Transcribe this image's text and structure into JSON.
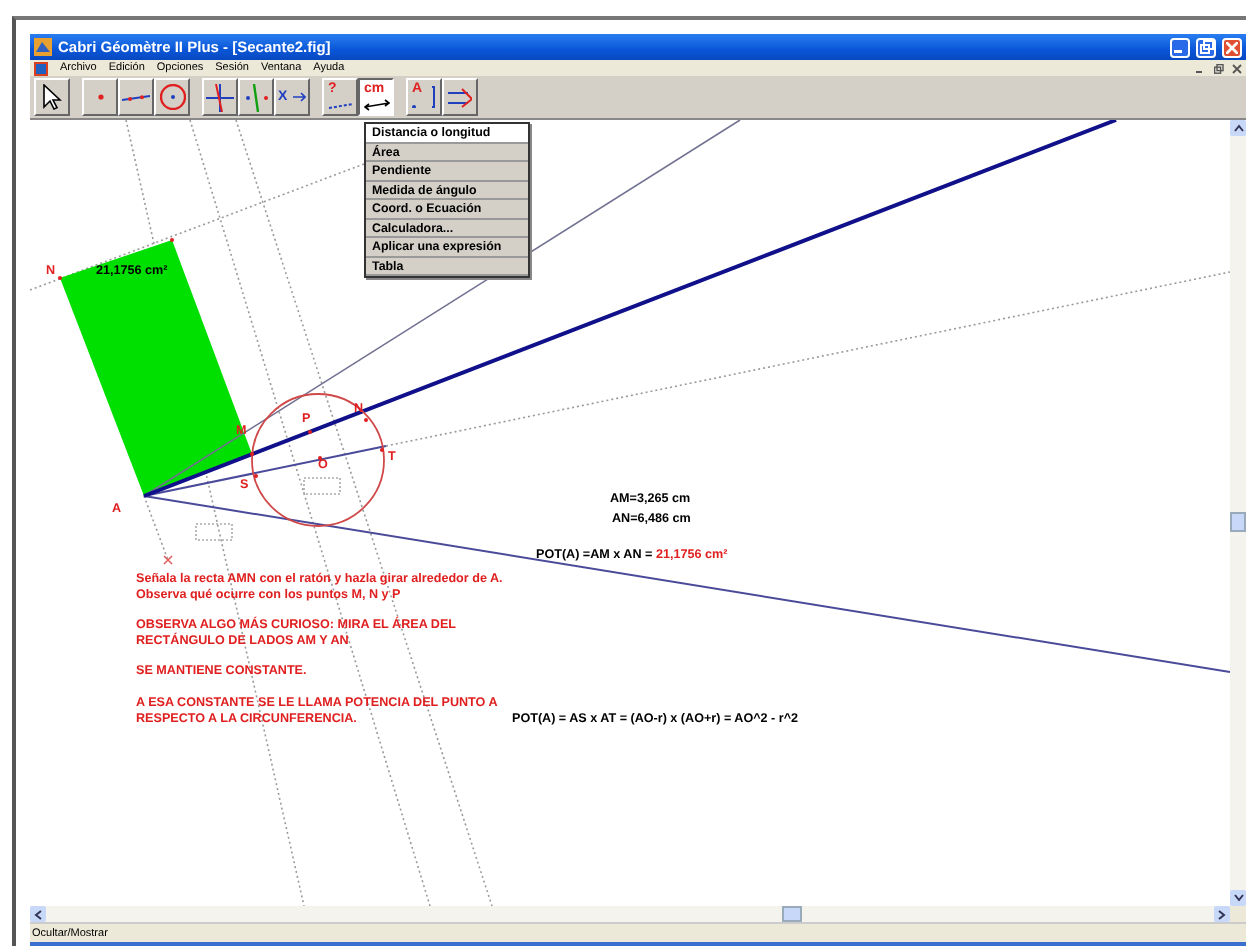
{
  "window": {
    "title": "Cabri Géomètre II Plus - [Secante2.fig]"
  },
  "menu_bar": [
    "Archivo",
    "Edición",
    "Opciones",
    "Sesión",
    "Ventana",
    "Ayuda"
  ],
  "toolbar": [
    {
      "kind": "pointer",
      "selected": false
    },
    {
      "kind": "point",
      "selected": false
    },
    {
      "kind": "line",
      "selected": false
    },
    {
      "kind": "circle",
      "selected": false
    },
    {
      "kind": "perpendicular",
      "selected": false
    },
    {
      "kind": "parallel",
      "selected": false
    },
    {
      "kind": "transform",
      "glyph": "X",
      "selected": false
    },
    {
      "kind": "check",
      "glyph": "?",
      "selected": false
    },
    {
      "kind": "measure",
      "glyph": "cm",
      "selected": true
    },
    {
      "kind": "label",
      "glyph": "A",
      "selected": false
    },
    {
      "kind": "display",
      "selected": false
    }
  ],
  "dropdown": {
    "items": [
      {
        "label": "Distancia o longitud",
        "selected": true
      },
      {
        "label": "Área",
        "selected": false
      },
      {
        "label": "Pendiente",
        "selected": false
      },
      {
        "label": "Medida de ángulo",
        "selected": false
      },
      {
        "label": "Coord. o Ecuación",
        "selected": false
      },
      {
        "label": "Calculadora...",
        "selected": false
      },
      {
        "label": "Aplicar una expresión",
        "selected": false
      },
      {
        "label": "Tabla",
        "selected": false
      }
    ]
  },
  "canvas": {
    "point_labels": [
      "N",
      "A",
      "M",
      "P",
      "N",
      "T",
      "S",
      "O"
    ],
    "area_label": "21,1756 cm²",
    "measures": [
      "AM=3,265 cm",
      "AN=6,486 cm"
    ],
    "formula": "POT(A) =AM x AN =",
    "formula_value": "21,1756  cm²",
    "instructions": [
      {
        "lines": [
          "Señala la recta AMN con el ratón y hazla girar alrededor de A.",
          "Observa qué ocurre con los puntos M, N y P"
        ]
      },
      {
        "lines": [
          "OBSERVA ALGO MÁS CURIOSO: MIRA EL ÁREA DEL",
          "RECTÁNGULO DE LADOS AM Y AN"
        ]
      },
      {
        "lines": [
          "SE MANTIENE CONSTANTE."
        ]
      },
      {
        "lines": [
          "A ESA CONSTANTE SE LE LLAMA POTENCIA DEL PUNTO A",
          "RESPECTO A LA CIRCUNFERENCIA."
        ]
      }
    ],
    "formula2": "POT(A) = AS x AT = (AO-r) x (AO+r) = AO^2 - r^2"
  },
  "status_bar": "Ocultar/Mostrar"
}
